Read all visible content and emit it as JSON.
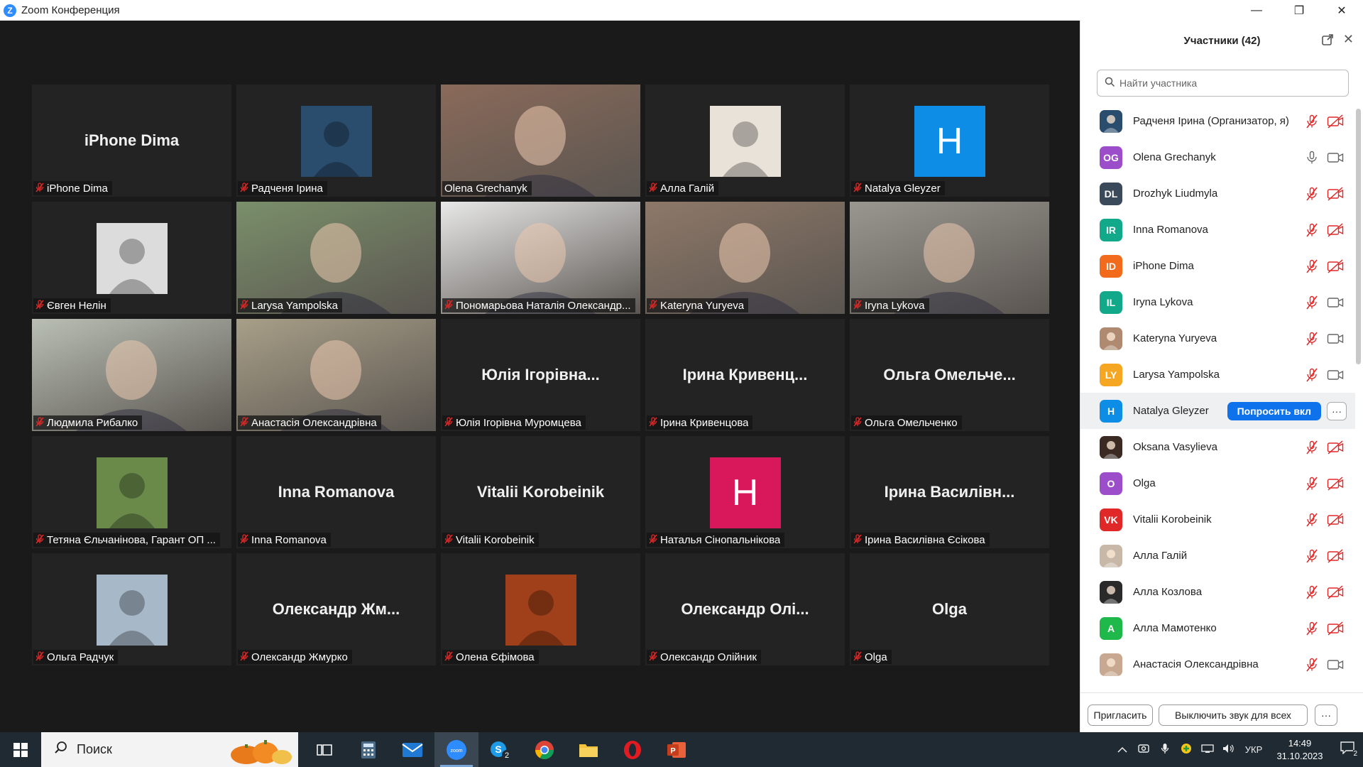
{
  "window": {
    "title": "Zoom Конференция",
    "controls": {
      "minimize": "—",
      "restore": "❐",
      "close": "✕"
    }
  },
  "grid": {
    "tiles": [
      {
        "label": "iPhone Dima",
        "display": "iPhone Dima",
        "kind": "name",
        "muted": true
      },
      {
        "label": "Радченя Ірина",
        "kind": "photo",
        "muted": true,
        "photo_bg": "#2a4d6e"
      },
      {
        "label": "Olena Grechanyk",
        "kind": "video",
        "muted": false,
        "active": true,
        "video_bg": "#8a6a5a"
      },
      {
        "label": "Алла Галій",
        "kind": "photo",
        "muted": true,
        "photo_bg": "#e9e2d8"
      },
      {
        "label": "Natalya Gleyzer",
        "kind": "letter",
        "letter": "H",
        "letter_bg": "#0e8de6",
        "muted": true
      },
      {
        "label": "Євген Нелін",
        "kind": "photo",
        "muted": true,
        "photo_bg": "#dcdcdc"
      },
      {
        "label": "Larysa Yampolska",
        "kind": "video",
        "muted": true,
        "video_bg": "#7a8f6a"
      },
      {
        "label": "Пономарьова Наталія Олександр...",
        "kind": "video",
        "muted": true,
        "video_bg": "#e8e8e8"
      },
      {
        "label": "Kateryna Yuryeva",
        "kind": "video",
        "muted": true,
        "video_bg": "#8e7868"
      },
      {
        "label": "Iryna Lykova",
        "kind": "video",
        "muted": true,
        "video_bg": "#9a9690"
      },
      {
        "label": "Людмила Рибалко",
        "kind": "video",
        "muted": true,
        "video_bg": "#b9bfb5"
      },
      {
        "label": "Анастасія Олександрівна",
        "kind": "video",
        "muted": true,
        "video_bg": "#a89f88"
      },
      {
        "label": "Юлія Ігорівна Муромцева",
        "display": "Юлія Ігорівна...",
        "kind": "name",
        "muted": true
      },
      {
        "label": "Ірина Кривенцова",
        "display": "Ірина Кривенц...",
        "kind": "name",
        "muted": true
      },
      {
        "label": "Ольга Омельченко",
        "display": "Ольга Омельче...",
        "kind": "name",
        "muted": true
      },
      {
        "label": "Тетяна Єльчанінова, Гарант ОП ...",
        "kind": "photo",
        "muted": true,
        "photo_bg": "#6a8a4a"
      },
      {
        "label": "Inna Romanova",
        "display": "Inna Romanova",
        "kind": "name",
        "muted": true
      },
      {
        "label": "Vitalii Korobeinik",
        "display": "Vitalii Korobeinik",
        "kind": "name",
        "muted": true
      },
      {
        "label": "Наталья Сінопальнікова",
        "kind": "letter",
        "letter": "H",
        "letter_bg": "#d9185c",
        "muted": true
      },
      {
        "label": "Ірина Василівна Єсікова",
        "display": "Ірина Василівн...",
        "kind": "name",
        "muted": true
      },
      {
        "label": "Ольга Радчук",
        "kind": "photo",
        "muted": true,
        "photo_bg": "#a7b9c9"
      },
      {
        "label": "Олександр Жмурко",
        "display": "Олександр Жм...",
        "kind": "name",
        "muted": true
      },
      {
        "label": "Олена Єфімова",
        "kind": "photo",
        "muted": true,
        "photo_bg": "#a0401a"
      },
      {
        "label": "Олександр Олійник",
        "display": "Олександр Олі...",
        "kind": "name",
        "muted": true
      },
      {
        "label": "Olga",
        "display": "Olga",
        "kind": "name",
        "muted": true
      }
    ]
  },
  "sidebar": {
    "title": "Участники (42)",
    "search_placeholder": "Найти участника",
    "participants": [
      {
        "name": "Радченя Ірина (Организатор, я)",
        "initials": "",
        "avatar_color": "#2a4d6e",
        "photo": true,
        "mic_muted": true,
        "cam_off": true
      },
      {
        "name": "Olena Grechanyk",
        "initials": "OG",
        "avatar_color": "#9b4dca",
        "mic_muted": false,
        "cam_off": false
      },
      {
        "name": "Drozhyk Liudmyla",
        "initials": "DL",
        "avatar_color": "#3b4a5a",
        "mic_muted": true,
        "cam_off": true
      },
      {
        "name": "Inna Romanova",
        "initials": "IR",
        "avatar_color": "#12a88a",
        "mic_muted": true,
        "cam_off": true
      },
      {
        "name": "iPhone Dima",
        "initials": "ID",
        "avatar_color": "#f26b1d",
        "mic_muted": true,
        "cam_off": true
      },
      {
        "name": "Iryna Lykova",
        "initials": "IL",
        "avatar_color": "#12a88a",
        "mic_muted": true,
        "cam_off": false
      },
      {
        "name": "Kateryna Yuryeva",
        "initials": "",
        "avatar_color": "#b08a70",
        "photo": true,
        "mic_muted": true,
        "cam_off": false
      },
      {
        "name": "Larysa Yampolska",
        "initials": "LY",
        "avatar_color": "#f5a623",
        "mic_muted": true,
        "cam_off": false
      },
      {
        "name": "Natalya Gleyzer",
        "initials": "H",
        "avatar_color": "#0e8de6",
        "hover": true,
        "action_label": "Попросить вкл",
        "more_label": "···"
      },
      {
        "name": "Oksana Vasylieva",
        "initials": "",
        "avatar_color": "#3a2a22",
        "photo": true,
        "mic_muted": true,
        "cam_off": true
      },
      {
        "name": "Olga",
        "initials": "O",
        "avatar_color": "#9b4dca",
        "mic_muted": true,
        "cam_off": true
      },
      {
        "name": "Vitalii Korobeinik",
        "initials": "VK",
        "avatar_color": "#e02828",
        "mic_muted": true,
        "cam_off": true
      },
      {
        "name": "Алла Галій",
        "initials": "",
        "avatar_color": "#c8b8a8",
        "photo": true,
        "mic_muted": true,
        "cam_off": true
      },
      {
        "name": "Алла Козлова",
        "initials": "",
        "avatar_color": "#2a2a2a",
        "photo": true,
        "mic_muted": true,
        "cam_off": true
      },
      {
        "name": "Алла Мамотенко",
        "initials": "A",
        "avatar_color": "#1fb84a",
        "mic_muted": true,
        "cam_off": true
      },
      {
        "name": "Анастасія Олександрівна",
        "initials": "",
        "avatar_color": "#c8a890",
        "photo": true,
        "mic_muted": true,
        "cam_off": false
      }
    ],
    "footer": {
      "invite": "Пригласить",
      "mute_all": "Выключить звук для всех",
      "more": "···"
    }
  },
  "taskbar": {
    "search_text": "Поиск",
    "apps": [
      "task-view",
      "calculator",
      "mail",
      "zoom",
      "skype",
      "chrome",
      "file-explorer",
      "opera",
      "powerpoint"
    ],
    "zoom_label": "zoom",
    "skype_badge": "2",
    "language": "УКР",
    "time": "14:49",
    "date": "31.10.2023",
    "notifications": "2"
  },
  "colors": {
    "accent_blue": "#0e72ed",
    "active_border": "#b6ff2d",
    "mute_red": "#e02828",
    "tile_bg": "#232323"
  }
}
